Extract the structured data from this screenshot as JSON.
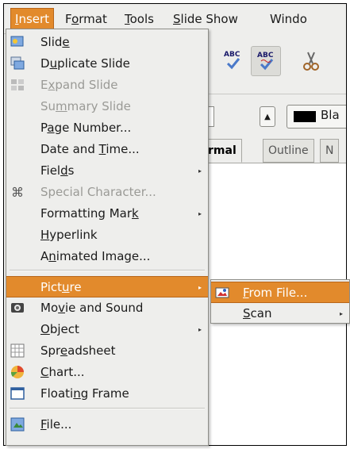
{
  "menubar": {
    "items": [
      {
        "label": "Insert",
        "mnemonic": "I",
        "rest": "nsert"
      },
      {
        "label": "Format",
        "mnemonic": "o",
        "pre": "F",
        "rest": "rmat"
      },
      {
        "label": "Tools",
        "mnemonic": "T",
        "rest": "ools"
      },
      {
        "label": "Slide Show",
        "mnemonic": "S",
        "rest": "lide Show"
      },
      {
        "label": "Windo"
      }
    ]
  },
  "toolbar": {
    "spell_abc": "ABC",
    "autospell_abc": "ABC",
    "font_color_label": "Bla"
  },
  "view_tabs": {
    "normal": "rmal",
    "outline": "Outline",
    "notes": "N"
  },
  "insert_menu": {
    "items": [
      {
        "label": "Slide",
        "pre": "Slid",
        "mn": "e",
        "post": "",
        "icon": "slide-icon",
        "disabled": false
      },
      {
        "label": "Duplicate Slide",
        "pre": "D",
        "mn": "u",
        "post": "plicate Slide",
        "icon": "duplicate-slide-icon",
        "disabled": false
      },
      {
        "label": "Expand Slide",
        "pre": "E",
        "mn": "x",
        "post": "pand Slide",
        "icon": "expand-slide-icon",
        "disabled": true
      },
      {
        "label": "Summary Slide",
        "pre": "Su",
        "mn": "m",
        "post": "mary Slide",
        "icon": "",
        "disabled": true
      },
      {
        "label": "Page Number...",
        "pre": "P",
        "mn": "a",
        "post": "ge Number...",
        "icon": "",
        "disabled": false
      },
      {
        "label": "Date and Time...",
        "pre": "Date and ",
        "mn": "T",
        "post": "ime...",
        "icon": "",
        "disabled": false
      },
      {
        "label": "Fields",
        "pre": "Fiel",
        "mn": "d",
        "post": "s",
        "icon": "",
        "disabled": false,
        "submenu": true
      },
      {
        "label": "Special Character...",
        "pre": "Special Character...",
        "mn": "",
        "post": "",
        "icon": "special-character-icon",
        "disabled": true
      },
      {
        "label": "Formatting Mark",
        "pre": "Formatting Mar",
        "mn": "k",
        "post": "",
        "icon": "",
        "disabled": false,
        "submenu": true
      },
      {
        "label": "Hyperlink",
        "pre": "",
        "mn": "H",
        "post": "yperlink",
        "icon": "",
        "disabled": false
      },
      {
        "label": "Animated Image...",
        "pre": "A",
        "mn": "n",
        "post": "imated Image...",
        "icon": "",
        "disabled": false
      },
      {
        "label": "Picture",
        "pre": "Pict",
        "mn": "u",
        "post": "re",
        "icon": "",
        "disabled": false,
        "submenu": true,
        "highlighted": true
      },
      {
        "label": "Movie and Sound",
        "pre": "Mo",
        "mn": "v",
        "post": "ie and Sound",
        "icon": "movie-sound-icon",
        "disabled": false
      },
      {
        "label": "Object",
        "pre": "",
        "mn": "O",
        "post": "bject",
        "icon": "",
        "disabled": false,
        "submenu": true
      },
      {
        "label": "Spreadsheet",
        "pre": "Spr",
        "mn": "e",
        "post": "adsheet",
        "icon": "spreadsheet-icon",
        "disabled": false
      },
      {
        "label": "Chart...",
        "pre": "",
        "mn": "C",
        "post": "hart...",
        "icon": "chart-icon",
        "disabled": false
      },
      {
        "label": "Floating Frame",
        "pre": "Floati",
        "mn": "n",
        "post": "g Frame",
        "icon": "floating-frame-icon",
        "disabled": false
      },
      {
        "label": "File...",
        "pre": "",
        "mn": "F",
        "post": "ile...",
        "icon": "file-icon",
        "disabled": false
      }
    ]
  },
  "picture_submenu": {
    "items": [
      {
        "label": "From File...",
        "pre": "",
        "mn": "F",
        "post": "rom File...",
        "highlighted": true,
        "icon": "from-file-icon"
      },
      {
        "label": "Scan",
        "pre": "",
        "mn": "S",
        "post": "can",
        "submenu": true
      }
    ]
  },
  "colors": {
    "highlight": "#e28a2c",
    "menu_bg": "#eeeeec",
    "disabled_text": "#9a9a96"
  }
}
